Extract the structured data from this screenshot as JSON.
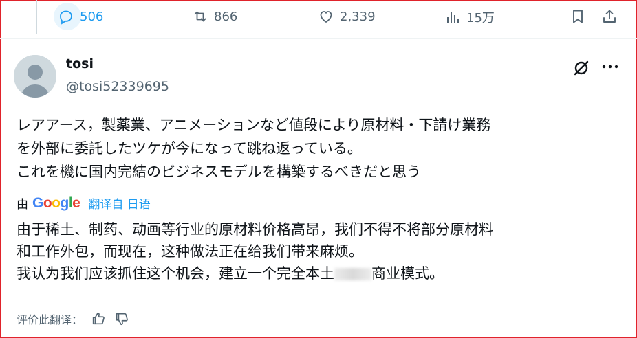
{
  "actions": {
    "replies": "506",
    "retweets": "866",
    "likes": "2,339",
    "views": "15万"
  },
  "author": {
    "display_name": "tosi",
    "handle": "@tosi52339695"
  },
  "post": {
    "lines": [
      "レアアース，製薬業、アニメーションなど値段により原材料・下請け業務",
      "を外部に委託したツケが今になって跳ね返っている。",
      "これを機に国内完結のビジネスモデルを構築するべきだと思う"
    ]
  },
  "translation_info": {
    "prefix": "由",
    "provider": "Google",
    "link": "翻译自 日语"
  },
  "translation": {
    "line1": "由于稀土、制药、动画等行业的原材料价格高昂，我们不得不将部分原材料",
    "line2": "和工作外包，而现在，这种做法正在给我们带来麻烦。",
    "line3_before": "我认为我们应该抓住这个机会，建立一个完全本土",
    "line3_after": "商业模式。"
  },
  "rate": {
    "label": "评价此翻译："
  },
  "colors": {
    "accent": "#1d9bf0",
    "text": "#0f1419",
    "muted": "#536471",
    "frame": "#e0232b"
  }
}
